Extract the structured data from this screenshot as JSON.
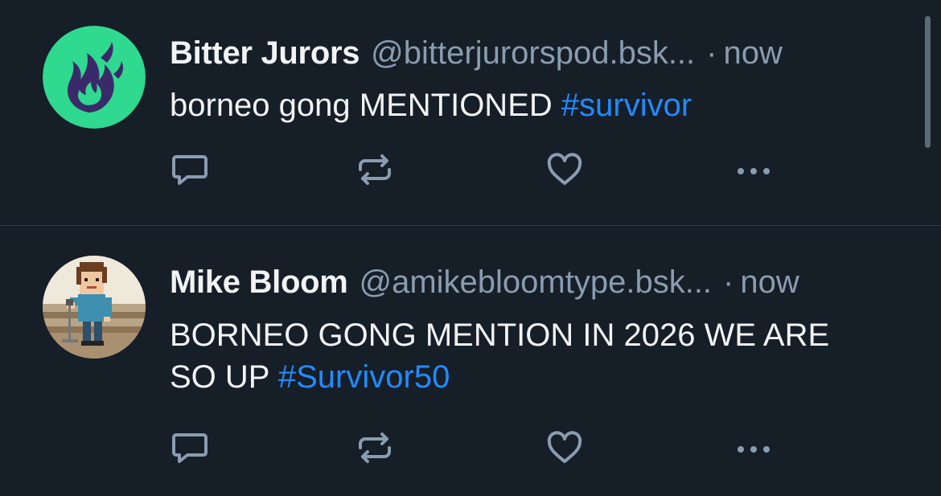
{
  "posts": [
    {
      "author": "Bitter Jurors",
      "handle": "@bitterjurorspod.bsk...",
      "separator": "·",
      "time": "now",
      "text": "borneo gong MENTIONED ",
      "hashtag": "#survivor",
      "avatar_icon": "flame-logo-icon"
    },
    {
      "author": "Mike Bloom",
      "handle": "@amikebloomtype.bsk...",
      "separator": "·",
      "time": "now",
      "text": "BORNEO GONG MENTION IN 2026 WE ARE SO UP ",
      "hashtag": "#Survivor50",
      "avatar_icon": "pixel-person-avatar"
    }
  ],
  "actions": [
    "reply",
    "repost",
    "like",
    "more"
  ],
  "colors": {
    "background": "#161e27",
    "text": "#f1f3f5",
    "muted": "#8a9cb0",
    "hashtag": "#208bfe",
    "avatar_green": "#2fd98f",
    "flame": "#3b2a6a"
  }
}
